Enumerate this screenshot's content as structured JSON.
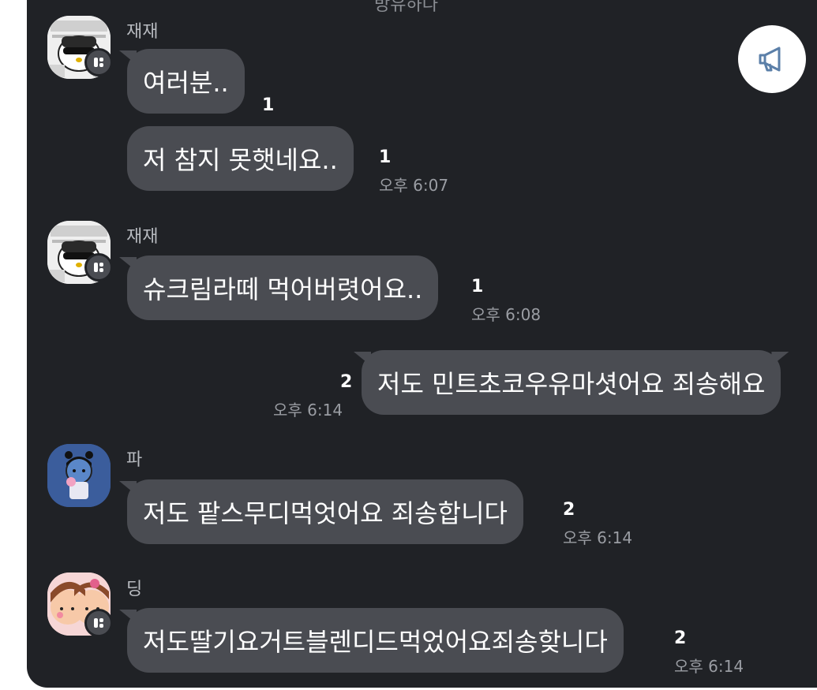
{
  "header": {
    "partial_text": "방유하다"
  },
  "notice": {
    "icon": "megaphone-icon"
  },
  "colors": {
    "background": "#202226",
    "bubble": "#4a4c52",
    "text": "#ffffff",
    "meta": "#9a9da3"
  },
  "messages": [
    {
      "sender": "재재",
      "text": "여러분..",
      "unread": "1",
      "time": ""
    },
    {
      "sender": "",
      "text": "저 참지 못햇네요..",
      "unread": "1",
      "time": "오후 6:07"
    },
    {
      "sender": "재재",
      "text": "슈크림라떼 먹어버렷어요..",
      "unread": "1",
      "time": "오후 6:08"
    },
    {
      "sender": "me",
      "text": "저도 민트초코우유마셧어요 죄송해요",
      "unread": "2",
      "time": "오후 6:14"
    },
    {
      "sender": "파",
      "text": "저도 팥스무디먹엇어요 죄송합니다",
      "unread": "2",
      "time": "오후 6:14"
    },
    {
      "sender": "딩",
      "text": "저도딸기요거트블렌디드먹었어요죄송핮니다",
      "unread": "2",
      "time": "오후 6:14"
    }
  ]
}
